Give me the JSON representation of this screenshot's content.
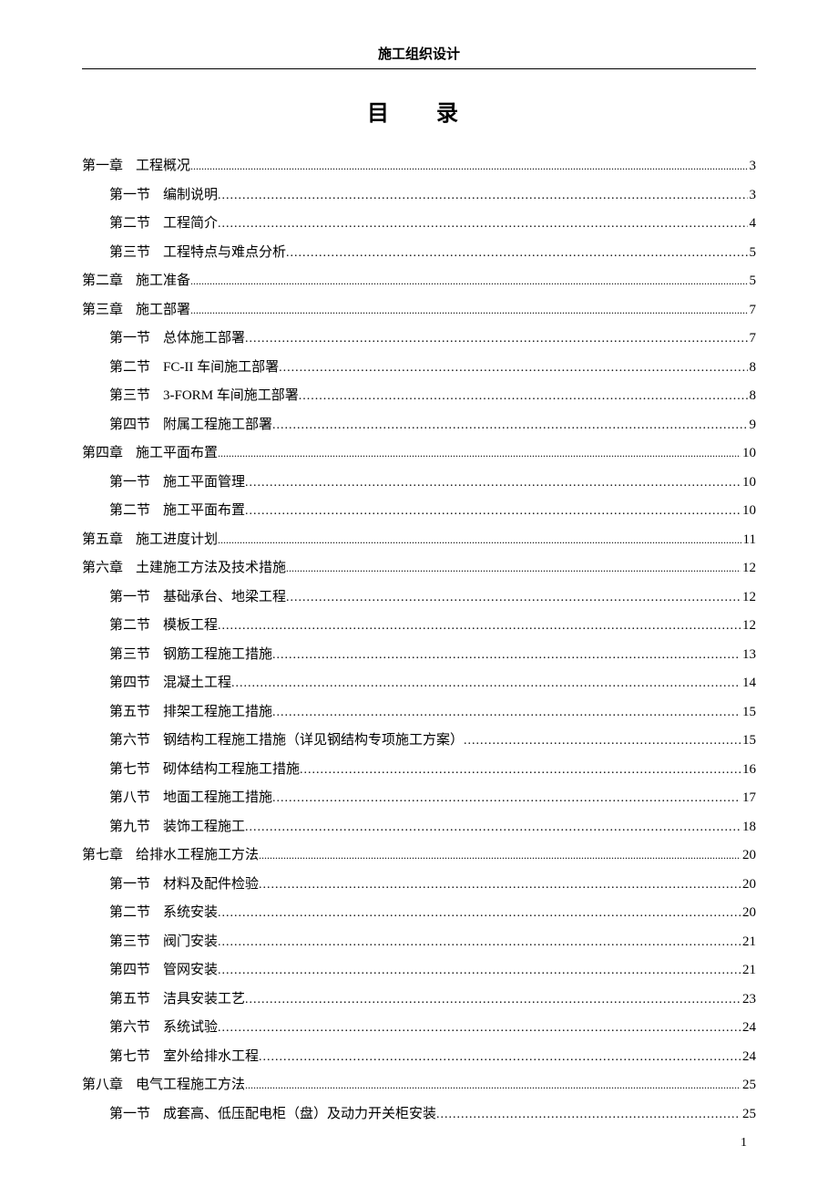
{
  "header_title": "施工组织设计",
  "toc_title": "目　录",
  "page_number": "1",
  "toc": [
    {
      "type": "chapter",
      "label": "第一章",
      "title": "工程概况",
      "page": "3"
    },
    {
      "type": "section",
      "label": "第一节",
      "title": "编制说明",
      "page": "3"
    },
    {
      "type": "section",
      "label": "第二节",
      "title": "工程简介",
      "page": "4"
    },
    {
      "type": "section",
      "label": "第三节",
      "title": "工程特点与难点分析",
      "page": "5"
    },
    {
      "type": "chapter",
      "label": "第二章",
      "title": "施工准备",
      "page": "5"
    },
    {
      "type": "chapter",
      "label": "第三章",
      "title": "施工部署",
      "page": "7"
    },
    {
      "type": "section",
      "label": "第一节",
      "title": "总体施工部署",
      "page": "7"
    },
    {
      "type": "section",
      "label": "第二节",
      "title": "FC-II 车间施工部署",
      "page": "8"
    },
    {
      "type": "section",
      "label": "第三节",
      "title": "3-FORM 车间施工部署",
      "page": "8"
    },
    {
      "type": "section",
      "label": "第四节",
      "title": "附属工程施工部署",
      "page": "9"
    },
    {
      "type": "chapter",
      "label": "第四章",
      "title": "施工平面布置",
      "page": "10"
    },
    {
      "type": "section",
      "label": "第一节",
      "title": "施工平面管理",
      "page": "10"
    },
    {
      "type": "section",
      "label": "第二节",
      "title": "施工平面布置",
      "page": "10"
    },
    {
      "type": "chapter",
      "label": "第五章",
      "title": "施工进度计划",
      "page": "11"
    },
    {
      "type": "chapter",
      "label": "第六章",
      "title": "土建施工方法及技术措施",
      "page": "12"
    },
    {
      "type": "section",
      "label": "第一节",
      "title": "基础承台、地梁工程",
      "page": "12"
    },
    {
      "type": "section",
      "label": "第二节",
      "title": "模板工程",
      "page": "12"
    },
    {
      "type": "section",
      "label": "第三节",
      "title": "钢筋工程施工措施",
      "page": "13"
    },
    {
      "type": "section",
      "label": "第四节",
      "title": "混凝土工程",
      "page": "14"
    },
    {
      "type": "section",
      "label": "第五节",
      "title": "排架工程施工措施",
      "page": "15"
    },
    {
      "type": "section",
      "label": "第六节",
      "title": "钢结构工程施工措施（详见钢结构专项施工方案）",
      "page": "15"
    },
    {
      "type": "section",
      "label": "第七节",
      "title": "砌体结构工程施工措施",
      "page": "16"
    },
    {
      "type": "section",
      "label": "第八节",
      "title": "地面工程施工措施",
      "page": "17"
    },
    {
      "type": "section",
      "label": "第九节",
      "title": "装饰工程施工",
      "page": "18"
    },
    {
      "type": "chapter",
      "label": "第七章",
      "title": "给排水工程施工方法",
      "page": "20"
    },
    {
      "type": "section",
      "label": "第一节",
      "title": "材料及配件检验",
      "page": "20"
    },
    {
      "type": "section",
      "label": "第二节",
      "title": "系统安装",
      "page": "20"
    },
    {
      "type": "section",
      "label": "第三节",
      "title": "阀门安装",
      "page": "21"
    },
    {
      "type": "section",
      "label": "第四节",
      "title": "管网安装",
      "page": "21"
    },
    {
      "type": "section",
      "label": "第五节",
      "title": "洁具安装工艺",
      "page": "23"
    },
    {
      "type": "section",
      "label": "第六节",
      "title": "系统试验",
      "page": "24"
    },
    {
      "type": "section",
      "label": "第七节",
      "title": "室外给排水工程",
      "page": "24"
    },
    {
      "type": "chapter",
      "label": "第八章",
      "title": "电气工程施工方法",
      "page": "25"
    },
    {
      "type": "section",
      "label": "第一节",
      "title": "成套高、低压配电柜（盘）及动力开关柜安装",
      "page": "25"
    }
  ]
}
